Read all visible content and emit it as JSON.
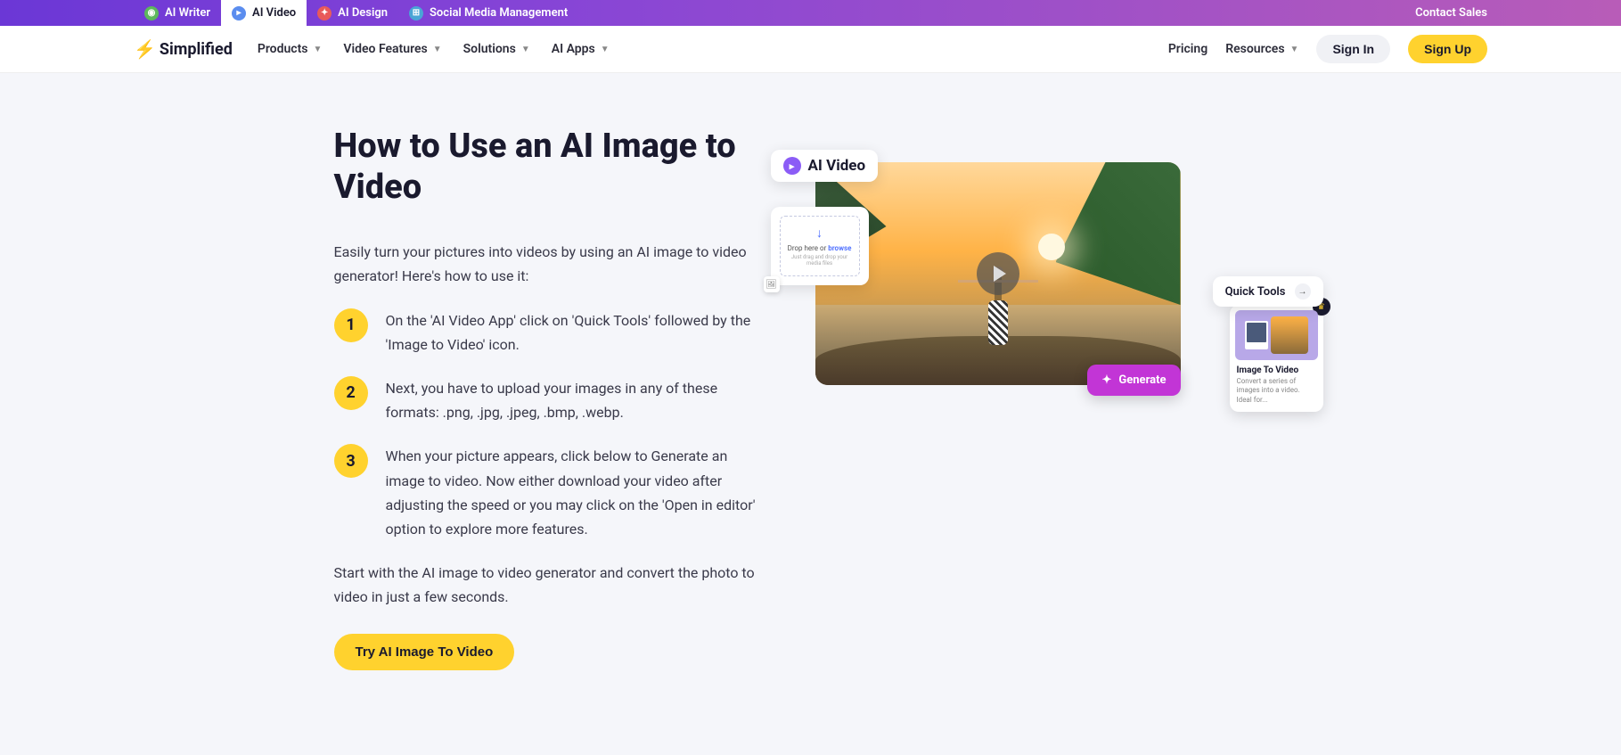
{
  "topbar": {
    "items": [
      {
        "label": "AI Writer",
        "icon_bg": "#5cb85c"
      },
      {
        "label": "AI Video",
        "icon_bg": "#5b8def",
        "active": true
      },
      {
        "label": "AI Design",
        "icon_bg": "#e85a5a"
      },
      {
        "label": "Social Media Management",
        "icon_bg": "#4aa5d6"
      }
    ],
    "contact": "Contact Sales"
  },
  "nav": {
    "logo": "Simplified",
    "items": [
      "Products",
      "Video Features",
      "Solutions",
      "AI Apps"
    ],
    "pricing": "Pricing",
    "resources": "Resources",
    "signin": "Sign In",
    "signup": "Sign Up"
  },
  "content": {
    "heading": "How to Use an AI Image to Video",
    "intro": "Easily turn your pictures into videos by using an AI image to video generator! Here's how to use it:",
    "steps": [
      "On the 'AI Video App' click on 'Quick Tools' followed by the 'Image to Video' icon.",
      "Next, you have to upload your images in any of these formats: .png, .jpg, .jpeg, .bmp, .webp.",
      "When your picture appears, click below to Generate an image to video. Now either download your video after adjusting the speed or you may click on the 'Open in editor' option to explore more features."
    ],
    "outro": "Start with the AI image to video generator and convert the photo to video in just a few seconds.",
    "cta": "Try AI Image To Video"
  },
  "hero": {
    "badge": "AI Video",
    "upload_text": "Drop here or ",
    "upload_browse": "browse",
    "upload_sub": "Just drag and drop your media files",
    "quick_tools": "Quick Tools",
    "generate": "Generate",
    "itv_title": "Image To Video",
    "itv_desc": "Convert a series of images into a video. Ideal for..."
  }
}
